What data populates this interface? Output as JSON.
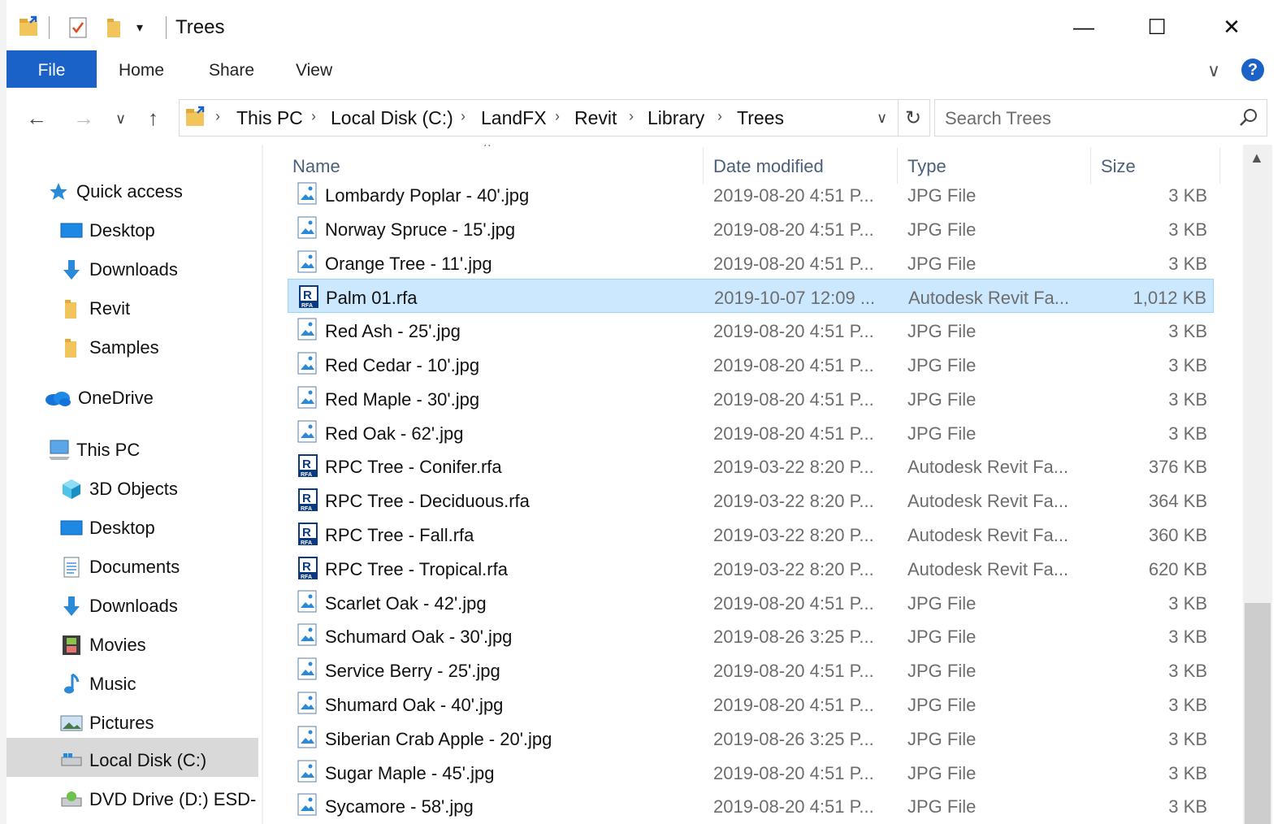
{
  "window": {
    "title": "Trees",
    "minimize": "—",
    "maximize": "☐",
    "close": "✕"
  },
  "ribbon": {
    "tabs": [
      "File",
      "Home",
      "Share",
      "View"
    ],
    "expand": "∨",
    "help": "?"
  },
  "nav": {
    "back": "←",
    "forward": "→",
    "recent": "∨",
    "up": "↑",
    "breadcrumb": [
      "This PC",
      "Local Disk (C:)",
      "LandFX",
      "Revit",
      "Library",
      "Trees"
    ],
    "sep": "›",
    "dropdown": "∨",
    "refresh": "↻",
    "search_placeholder": "Search Trees"
  },
  "navpane": {
    "quick_access": "Quick access",
    "quick_items": [
      "Desktop",
      "Downloads",
      "Revit",
      "Samples"
    ],
    "onedrive": "OneDrive",
    "this_pc": "This PC",
    "pc_items": [
      "3D Objects",
      "Desktop",
      "Documents",
      "Downloads",
      "Movies",
      "Music",
      "Pictures",
      "Local Disk (C:)",
      "DVD Drive (D:) ESD-"
    ]
  },
  "columns": {
    "name": "Name",
    "date": "Date modified",
    "type": "Type",
    "size": "Size",
    "sort_indicator": "^"
  },
  "files": [
    {
      "name": "Lombardy Poplar - 40'.jpg",
      "date": "2019-08-20 4:51 P...",
      "type": "JPG File",
      "size": "3 KB",
      "icon": "jpg-icon"
    },
    {
      "name": "Norway Spruce - 15'.jpg",
      "date": "2019-08-20 4:51 P...",
      "type": "JPG File",
      "size": "3 KB",
      "icon": "jpg-icon"
    },
    {
      "name": "Orange Tree - 11'.jpg",
      "date": "2019-08-20 4:51 P...",
      "type": "JPG File",
      "size": "3 KB",
      "icon": "jpg-icon"
    },
    {
      "name": "Palm 01.rfa",
      "date": "2019-10-07 12:09 ...",
      "type": "Autodesk Revit Fa...",
      "size": "1,012 KB",
      "icon": "rfa-icon",
      "selected": true
    },
    {
      "name": "Red Ash - 25'.jpg",
      "date": "2019-08-20 4:51 P...",
      "type": "JPG File",
      "size": "3 KB",
      "icon": "jpg-icon"
    },
    {
      "name": "Red Cedar - 10'.jpg",
      "date": "2019-08-20 4:51 P...",
      "type": "JPG File",
      "size": "3 KB",
      "icon": "jpg-icon"
    },
    {
      "name": "Red Maple - 30'.jpg",
      "date": "2019-08-20 4:51 P...",
      "type": "JPG File",
      "size": "3 KB",
      "icon": "jpg-icon"
    },
    {
      "name": "Red Oak - 62'.jpg",
      "date": "2019-08-20 4:51 P...",
      "type": "JPG File",
      "size": "3 KB",
      "icon": "jpg-icon"
    },
    {
      "name": "RPC Tree - Conifer.rfa",
      "date": "2019-03-22 8:20 P...",
      "type": "Autodesk Revit Fa...",
      "size": "376 KB",
      "icon": "rfa-icon"
    },
    {
      "name": "RPC Tree - Deciduous.rfa",
      "date": "2019-03-22 8:20 P...",
      "type": "Autodesk Revit Fa...",
      "size": "364 KB",
      "icon": "rfa-icon"
    },
    {
      "name": "RPC Tree - Fall.rfa",
      "date": "2019-03-22 8:20 P...",
      "type": "Autodesk Revit Fa...",
      "size": "360 KB",
      "icon": "rfa-icon"
    },
    {
      "name": "RPC Tree - Tropical.rfa",
      "date": "2019-03-22 8:20 P...",
      "type": "Autodesk Revit Fa...",
      "size": "620 KB",
      "icon": "rfa-icon"
    },
    {
      "name": "Scarlet Oak - 42'.jpg",
      "date": "2019-08-20 4:51 P...",
      "type": "JPG File",
      "size": "3 KB",
      "icon": "jpg-icon"
    },
    {
      "name": "Schumard Oak - 30'.jpg",
      "date": "2019-08-26 3:25 P...",
      "type": "JPG File",
      "size": "3 KB",
      "icon": "jpg-icon"
    },
    {
      "name": "Service Berry - 25'.jpg",
      "date": "2019-08-20 4:51 P...",
      "type": "JPG File",
      "size": "3 KB",
      "icon": "jpg-icon"
    },
    {
      "name": "Shumard Oak - 40'.jpg",
      "date": "2019-08-20 4:51 P...",
      "type": "JPG File",
      "size": "3 KB",
      "icon": "jpg-icon"
    },
    {
      "name": "Siberian Crab Apple - 20'.jpg",
      "date": "2019-08-26 3:25 P...",
      "type": "JPG File",
      "size": "3 KB",
      "icon": "jpg-icon"
    },
    {
      "name": "Sugar Maple - 45'.jpg",
      "date": "2019-08-20 4:51 P...",
      "type": "JPG File",
      "size": "3 KB",
      "icon": "jpg-icon"
    },
    {
      "name": "Sycamore - 58'.jpg",
      "date": "2019-08-20 4:51 P...",
      "type": "JPG File",
      "size": "3 KB",
      "icon": "jpg-icon"
    }
  ],
  "colors": {
    "accent": "#1a62c7",
    "selection": "#cce8ff",
    "selection_border": "#99d1ff",
    "muted_text": "#6d6d6d",
    "header_text": "#4c607a"
  }
}
